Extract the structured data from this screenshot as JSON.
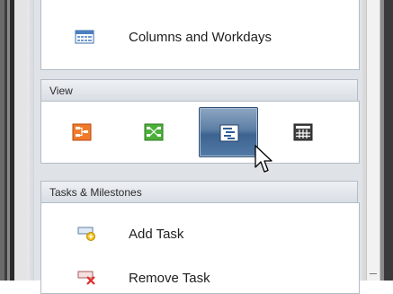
{
  "top_section": {
    "item": {
      "label": "Columns and Workdays",
      "icon": "columns-grid-icon"
    }
  },
  "view_section": {
    "title": "View",
    "buttons": [
      {
        "icon": "hierarchy-chart-icon",
        "color": "#e8601c"
      },
      {
        "icon": "network-diagram-icon",
        "color": "#3e9b2e"
      },
      {
        "icon": "gantt-chart-icon",
        "color": "#2e5f96",
        "selected": true
      },
      {
        "icon": "table-grid-icon",
        "color": "#3a3a3a"
      }
    ]
  },
  "tasks_section": {
    "title": "Tasks & Milestones",
    "items": [
      {
        "label": "Add Task",
        "icon": "add-task-icon"
      },
      {
        "label": "Remove Task",
        "icon": "remove-task-icon"
      }
    ]
  },
  "colors": {
    "panel_bg": "#dfe3e8",
    "header_border": "#b5bcc6",
    "selected_btn": "#3d6490"
  }
}
